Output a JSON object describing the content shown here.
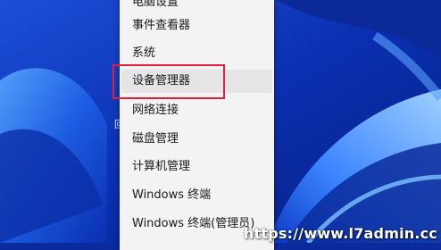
{
  "context_menu": {
    "items": [
      {
        "label": "电脑设置"
      },
      {
        "label": "事件查看器"
      },
      {
        "label": "系统"
      },
      {
        "label": "设备管理器"
      },
      {
        "label": "网络连接"
      },
      {
        "label": "磁盘管理"
      },
      {
        "label": "计算机管理"
      },
      {
        "label": "Windows 终端"
      },
      {
        "label": "Windows 终端(管理员)"
      }
    ]
  },
  "desktop": {
    "edge_letter": "回",
    "accent_color": "#0a2a9e",
    "highlight_color": "#e0203a"
  },
  "watermark": "https://www.l7admin.cc"
}
